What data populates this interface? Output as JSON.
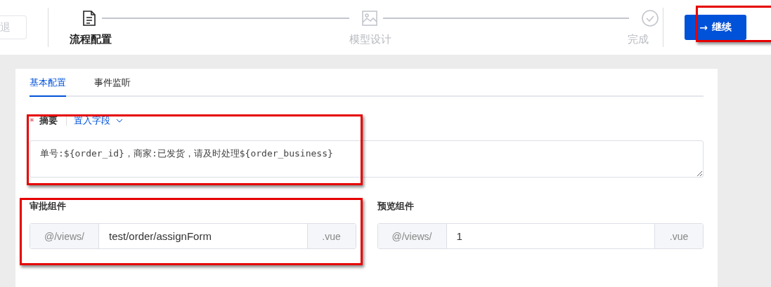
{
  "toolbar": {
    "back_button": {
      "label": "退",
      "disabled": true
    },
    "steps": [
      {
        "label": "流程配置",
        "current": true
      },
      {
        "label": "模型设计",
        "current": false
      },
      {
        "label": "完成",
        "current": false
      }
    ],
    "continue_button": {
      "arrow": "→",
      "label": "继续",
      "highlighted": true
    }
  },
  "tabs": [
    {
      "label": "基本配置",
      "selected": true
    },
    {
      "label": "事件监听",
      "selected": false
    }
  ],
  "summary": {
    "required_mark": "*",
    "label": "摘要",
    "insert_field": "置入字段",
    "value": "单号:${order_id}，商家:已发货，请及时处理${order_business}",
    "highlighted": true
  },
  "components": [
    {
      "label": "审批组件",
      "prefix": "@/views/",
      "value": "test/order/assignForm",
      "suffix": ".vue",
      "highlighted": true
    },
    {
      "label": "预览组件",
      "prefix": "@/views/",
      "value": "1",
      "suffix": ".vue",
      "highlighted": false
    }
  ]
}
